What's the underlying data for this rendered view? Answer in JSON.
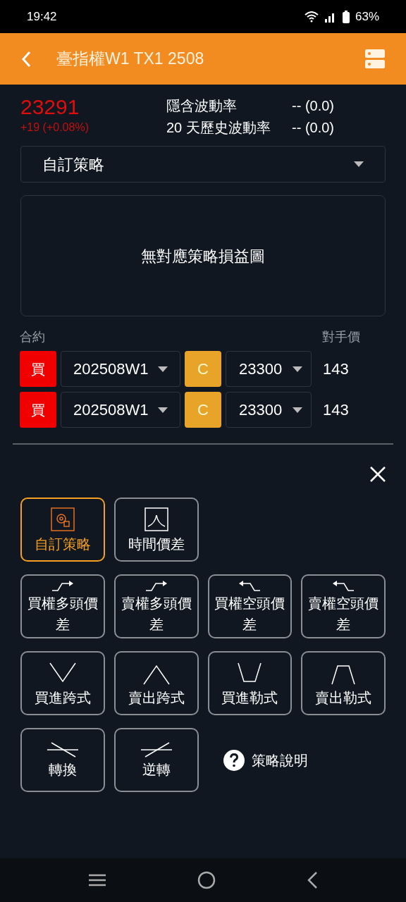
{
  "status_bar": {
    "time": "19:42",
    "battery": "63%"
  },
  "header": {
    "title": "臺指權W1 TX1 2508"
  },
  "quote": {
    "price": "23291",
    "change": "+19 (+0.08%)"
  },
  "volatility": [
    {
      "label": "隱含波動率",
      "value": "-- (0.0)"
    },
    {
      "label": "20 天歷史波動率",
      "value": "-- (0.0)"
    }
  ],
  "strategy_select": {
    "value": "自訂策略"
  },
  "chart_placeholder": "無對應策略損益圖",
  "legs_header": {
    "contract": "合約",
    "price": "對手價"
  },
  "legs": [
    {
      "side": "買",
      "expiry": "202508W1",
      "type": "C",
      "strike": "23300",
      "price": "143"
    },
    {
      "side": "買",
      "expiry": "202508W1",
      "type": "C",
      "strike": "23300",
      "price": "143"
    }
  ],
  "strategies": [
    [
      {
        "kind": "custom",
        "label": "自訂策略",
        "selected": true
      },
      {
        "kind": "calendar",
        "label": "時間價差",
        "selected": false
      }
    ],
    [
      {
        "kind": "rise",
        "label": "買權多頭價差",
        "selected": false
      },
      {
        "kind": "rise",
        "label": "賣權多頭價差",
        "selected": false
      },
      {
        "kind": "fall",
        "label": "買權空頭價差",
        "selected": false
      },
      {
        "kind": "fall",
        "label": "賣權空頭價差",
        "selected": false
      }
    ],
    [
      {
        "kind": "v",
        "label": "買進跨式",
        "selected": false
      },
      {
        "kind": "peak",
        "label": "賣出跨式",
        "selected": false
      },
      {
        "kind": "trough",
        "label": "買進勒式",
        "selected": false
      },
      {
        "kind": "plateau",
        "label": "賣出勒式",
        "selected": false
      }
    ],
    [
      {
        "kind": "conversion",
        "label": "轉換",
        "selected": false
      },
      {
        "kind": "reversal",
        "label": "逆轉",
        "selected": false
      }
    ]
  ],
  "help_link": "策略說明"
}
